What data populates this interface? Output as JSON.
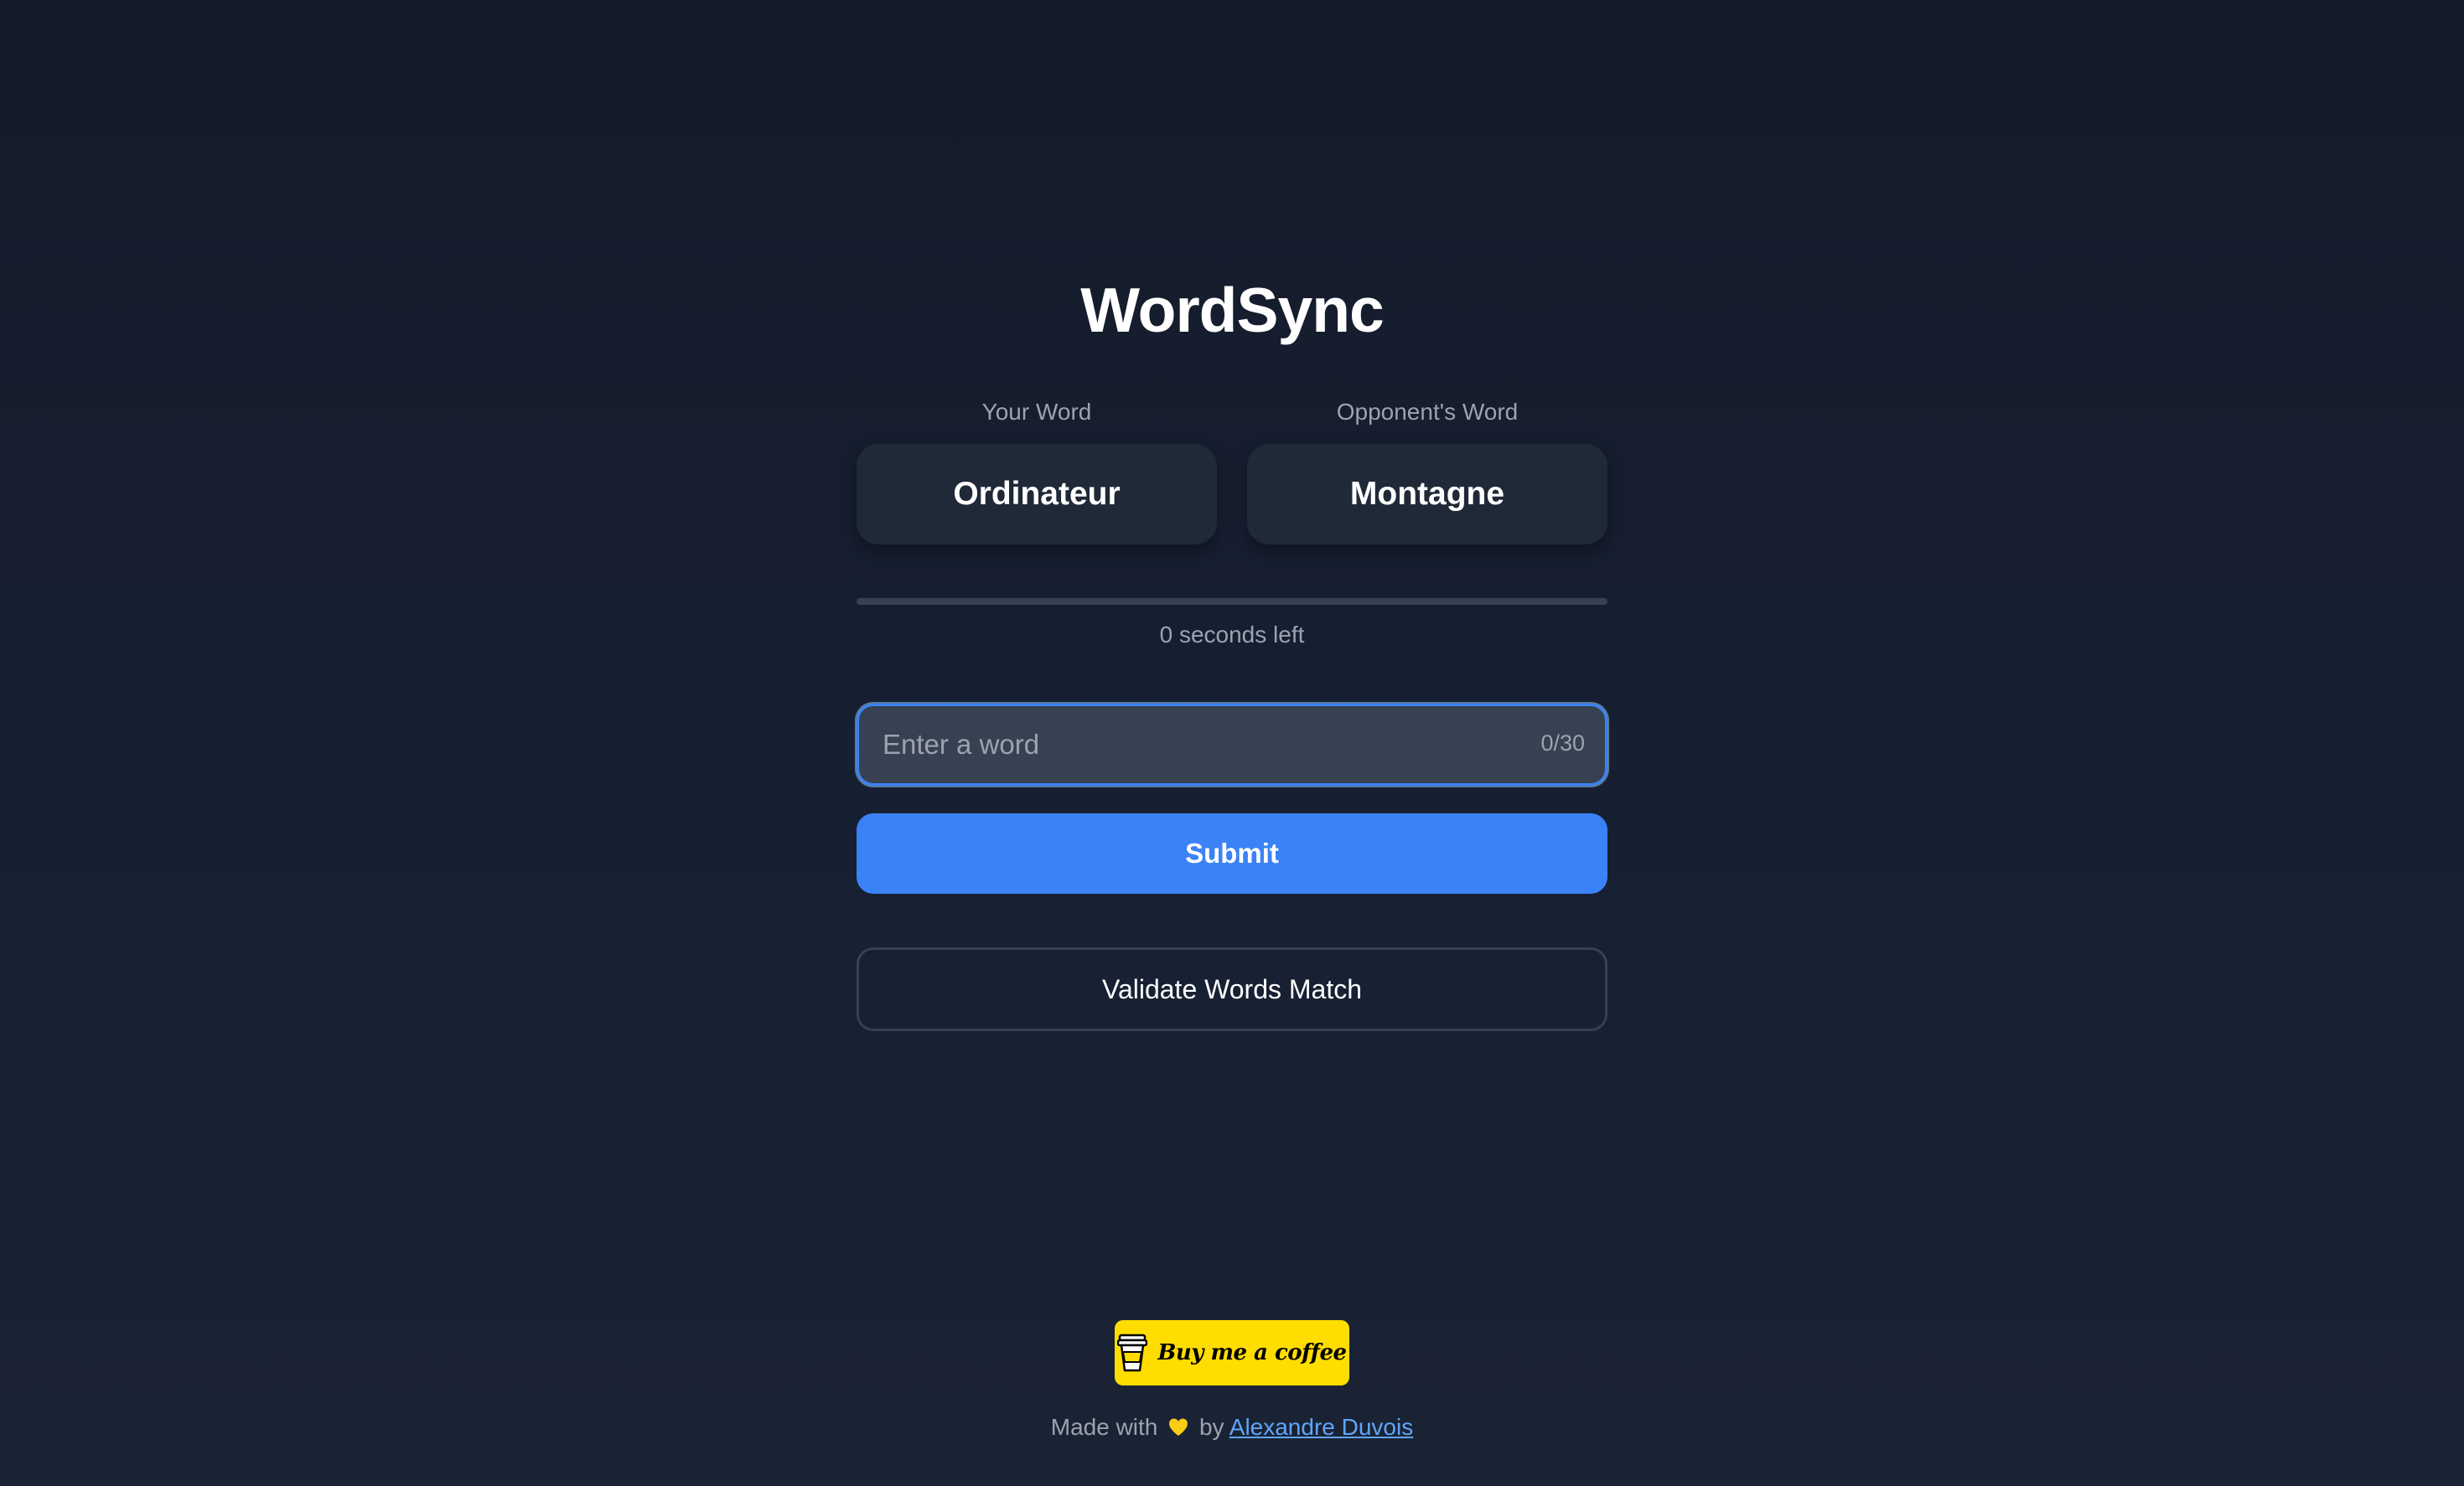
{
  "app": {
    "title": "WordSync"
  },
  "words": {
    "your_label": "Your Word",
    "your_word": "Ordinateur",
    "opponent_label": "Opponent's Word",
    "opponent_word": "Montagne"
  },
  "timer": {
    "text": "0 seconds left",
    "progress_fraction": 0
  },
  "input": {
    "value": "",
    "placeholder": "Enter a word",
    "char_count": "0/30"
  },
  "actions": {
    "submit_label": "Submit",
    "validate_label": "Validate Words Match"
  },
  "footer": {
    "bmc_label": "Buy me a coffee",
    "made_with_prefix": "Made with",
    "by_text": "by",
    "author": "Alexandre Duvois"
  },
  "colors": {
    "accent": "#3b82f6",
    "card": "#1f2937",
    "muted_text": "#9ca3af",
    "link": "#60a5fa",
    "bmc_yellow": "#ffdd00",
    "heart": "#facc15"
  }
}
